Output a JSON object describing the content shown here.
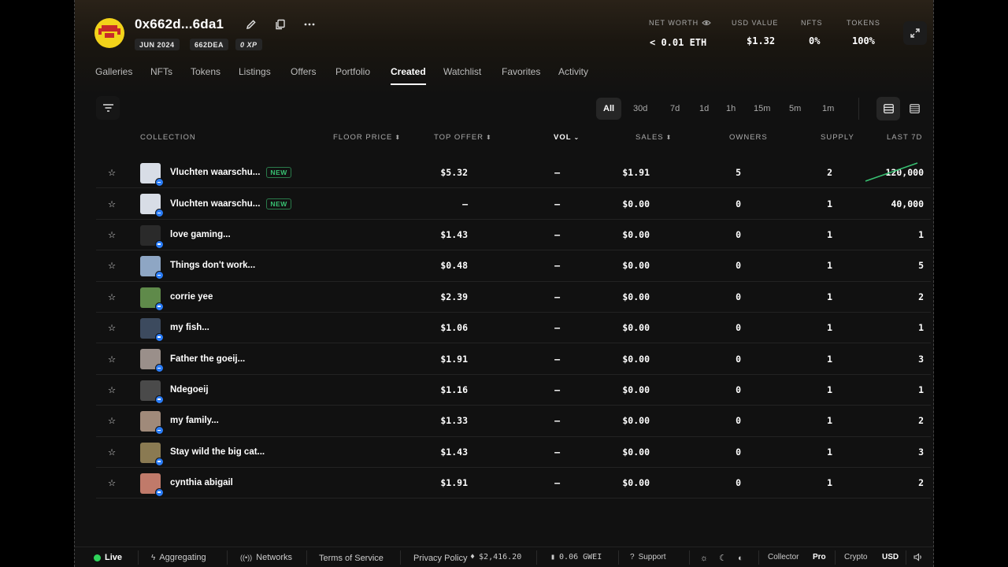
{
  "profile": {
    "name": "0x662d...6da1",
    "chips": [
      "JUN 2024",
      "662DEA",
      "0 XP"
    ]
  },
  "stats": {
    "net_worth_label": "NET WORTH",
    "net_worth_value": "< 0.01 ETH",
    "usd_label": "USD VALUE",
    "usd_value": "$1.32",
    "nfts_label": "NFTS",
    "nfts_value": "0%",
    "tokens_label": "TOKENS",
    "tokens_value": "100%"
  },
  "tabs": [
    "Galleries",
    "NFTs",
    "Tokens",
    "Listings",
    "Offers",
    "Portfolio",
    "Created",
    "Watchlist",
    "Favorites",
    "Activity"
  ],
  "active_tab": "Created",
  "time_filters": [
    "All",
    "30d",
    "7d",
    "1d",
    "1h",
    "15m",
    "5m",
    "1m"
  ],
  "active_time_filter": "All",
  "columns": {
    "collection": "COLLECTION",
    "floor": "FLOOR PRICE",
    "top_offer": "TOP OFFER",
    "vol": "VOL",
    "sales": "SALES",
    "owners": "OWNERS",
    "supply": "SUPPLY",
    "last7d": "LAST 7D"
  },
  "new_badge": "NEW",
  "rows": [
    {
      "name": "Vluchten waarschu...",
      "is_new": true,
      "floor": "$5.32",
      "top_offer": "–",
      "vol": "$1.91",
      "sales": "5",
      "owners": "2",
      "supply": "120,000",
      "thumb": "#d8dde6",
      "spark": true
    },
    {
      "name": "Vluchten waarschu...",
      "is_new": true,
      "floor": "–",
      "top_offer": "–",
      "vol": "$0.00",
      "sales": "0",
      "owners": "1",
      "supply": "40,000",
      "thumb": "#d8dde6"
    },
    {
      "name": "love gaming...",
      "floor": "$1.43",
      "top_offer": "–",
      "vol": "$0.00",
      "sales": "0",
      "owners": "1",
      "supply": "1",
      "thumb": "#2a2a2a"
    },
    {
      "name": "Things don't work...",
      "floor": "$0.48",
      "top_offer": "–",
      "vol": "$0.00",
      "sales": "0",
      "owners": "1",
      "supply": "5",
      "thumb": "#8ea6c4"
    },
    {
      "name": "corrie yee",
      "floor": "$2.39",
      "top_offer": "–",
      "vol": "$0.00",
      "sales": "0",
      "owners": "1",
      "supply": "2",
      "thumb": "#5f8a4a"
    },
    {
      "name": "my fish...",
      "floor": "$1.06",
      "top_offer": "–",
      "vol": "$0.00",
      "sales": "0",
      "owners": "1",
      "supply": "1",
      "thumb": "#3c4a5e"
    },
    {
      "name": "Father the goeij...",
      "floor": "$1.91",
      "top_offer": "–",
      "vol": "$0.00",
      "sales": "0",
      "owners": "1",
      "supply": "3",
      "thumb": "#9a8f8a"
    },
    {
      "name": "Ndegoeij",
      "floor": "$1.16",
      "top_offer": "–",
      "vol": "$0.00",
      "sales": "0",
      "owners": "1",
      "supply": "1",
      "thumb": "#4a4a4a"
    },
    {
      "name": "my family...",
      "floor": "$1.33",
      "top_offer": "–",
      "vol": "$0.00",
      "sales": "0",
      "owners": "1",
      "supply": "2",
      "thumb": "#a08a7a"
    },
    {
      "name": "Stay wild the big cat...",
      "floor": "$1.43",
      "top_offer": "–",
      "vol": "$0.00",
      "sales": "0",
      "owners": "1",
      "supply": "3",
      "thumb": "#8a7a52"
    },
    {
      "name": "cynthia abigail",
      "floor": "$1.91",
      "top_offer": "–",
      "vol": "$0.00",
      "sales": "0",
      "owners": "1",
      "supply": "2",
      "thumb": "#c07a6a"
    }
  ],
  "footer": {
    "live": "Live",
    "aggregating": "Aggregating",
    "networks": "Networks",
    "terms": "Terms of Service",
    "privacy": "Privacy Policy",
    "eth_price": "$2,416.20",
    "gas": "0.06 GWEI",
    "support": "Support",
    "collector": "Collector",
    "pro": "Pro",
    "crypto": "Crypto",
    "usd": "USD"
  },
  "colors": {
    "accent_green": "#38c172",
    "live_green": "#2fd35a",
    "badge_blue": "#2a7cf6",
    "avatar_yellow": "#f2d21a",
    "avatar_red": "#c7292a"
  }
}
